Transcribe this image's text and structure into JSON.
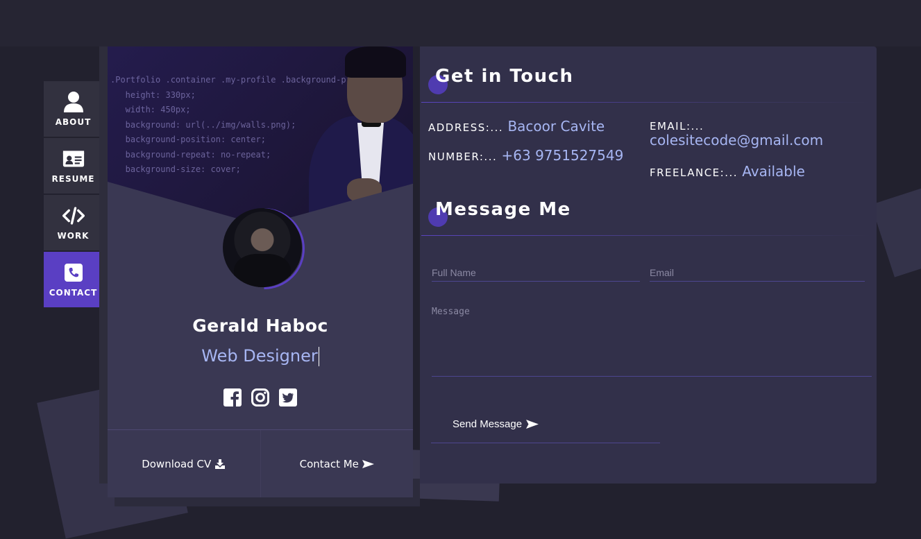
{
  "nav": {
    "items": [
      {
        "label": "ABOUT",
        "icon": "user-icon"
      },
      {
        "label": "RESUME",
        "icon": "id-card-icon"
      },
      {
        "label": "WORK",
        "icon": "code-icon"
      },
      {
        "label": "CONTACT",
        "icon": "phone-icon",
        "active": true
      }
    ]
  },
  "profile": {
    "cover_code": ".Portfolio .container .my-profile .background-profile {\n   height: 330px;\n   width: 450px;\n   background: url(../img/walls.png);\n   background-position: center;\n   background-repeat: no-repeat;\n   background-size: cover;",
    "name": "Gerald Haboc",
    "role": "Web Designer",
    "social": [
      "facebook-icon",
      "instagram-icon",
      "twitter-icon"
    ],
    "download_cv": "Download CV",
    "contact_me": "Contact Me"
  },
  "contact": {
    "title": "Get in Touch",
    "address_label": "ADDRESS:...",
    "address_value": "Bacoor Cavite",
    "number_label": "NUMBER:...",
    "number_value": "+63 9751527549",
    "email_label": "EMAIL:...",
    "email_value": "colesitecode@gmail.com",
    "freelance_label": "FREELANCE:...",
    "freelance_value": "Available"
  },
  "message": {
    "title": "Message Me",
    "fullname_placeholder": "Full Name",
    "email_placeholder": "Email",
    "message_placeholder": "Message",
    "send_label": "Send Message"
  },
  "colors": {
    "accent": "#5a3fc3",
    "value_text": "#a7b6f3",
    "background": "#22212e"
  }
}
